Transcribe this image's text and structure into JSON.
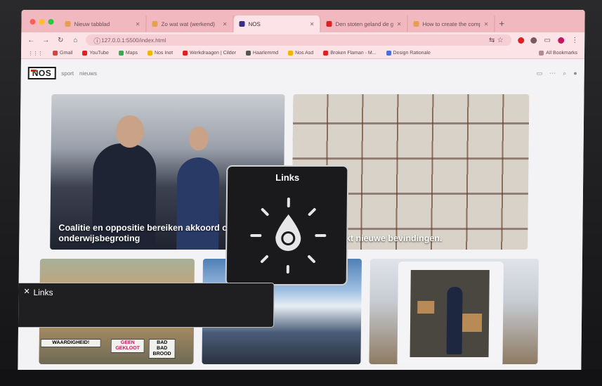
{
  "browser": {
    "tabs": [
      {
        "label": "Nieuw tabblad",
        "active": false,
        "favicon_color": "#e8a04c"
      },
      {
        "label": "Zo wat wat (werkend)",
        "active": false,
        "favicon_color": "#e8a04c"
      },
      {
        "label": "NOS",
        "active": true,
        "favicon_color": "#3a2e88"
      },
      {
        "label": "Den stoten geland de grote",
        "active": false,
        "favicon_color": "#e02020"
      },
      {
        "label": "How to create the computer",
        "active": false,
        "favicon_color": "#e8a04c"
      }
    ],
    "new_tab_symbol": "+",
    "url": "127.0.0.1:5500/index.html",
    "bookmarks": [
      {
        "label": "Gmail",
        "color": "#d44638"
      },
      {
        "label": "YouTube",
        "color": "#e02020"
      },
      {
        "label": "Maps",
        "color": "#34a853"
      },
      {
        "label": "Nos Inet",
        "color": "#f1b500"
      },
      {
        "label": "Werkdraagen | Cilder",
        "color": "#e02020"
      },
      {
        "label": "Haarlemmd",
        "color": "#555"
      },
      {
        "label": "Nos Asd",
        "color": "#f1b500"
      },
      {
        "label": "Broken Flaman - M...",
        "color": "#e02020"
      },
      {
        "label": "Design Rationale",
        "color": "#4a6fd8"
      }
    ],
    "all_bookmarks": "All Bookmarks"
  },
  "nos": {
    "logo": "NOS",
    "nav": [
      "sport",
      "nieuws"
    ],
    "cards": [
      {
        "caption": "Coalitie en oppositie bereiken akkoord over onderwijsbegroting"
      },
      {
        "caption": "Japan maakt nieuwe bevindingen."
      }
    ],
    "signs": [
      "WAARDIGHEID!",
      "GEEN GEKLOOT",
      "BAD BAD BROOD"
    ]
  },
  "popover": {
    "title": "Links"
  },
  "links_bar": {
    "close_symbol": "✕",
    "label": "Links"
  }
}
